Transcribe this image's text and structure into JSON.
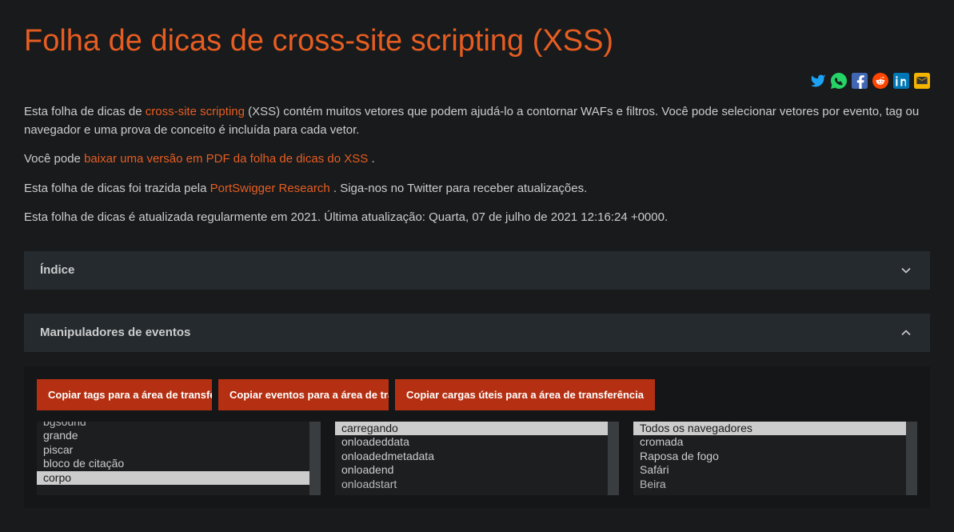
{
  "title": "Folha de dicas de cross-site scripting (XSS)",
  "social": {
    "twitter": "twitter-icon",
    "whatsapp": "whatsapp-icon",
    "facebook": "facebook-icon",
    "reddit": "reddit-icon",
    "linkedin": "linkedin-icon",
    "email": "email-icon"
  },
  "intro": {
    "p1_a": "Esta folha de dicas de ",
    "p1_link": "cross-site scripting",
    "p1_b": " (XSS) contém muitos vetores que podem ajudá-lo a contornar WAFs e filtros. Você pode selecionar vetores por evento, tag ou navegador e uma prova de conceito é incluída para cada vetor.",
    "p2_a": "Você pode ",
    "p2_link": "baixar uma versão em PDF da folha de dicas do XSS ",
    "p2_b": ".",
    "p3_a": "Esta folha de dicas foi trazida pela ",
    "p3_link": "PortSwigger Research ",
    "p3_b": ". Siga-nos no Twitter para receber atualizações.",
    "p4": "Esta folha de dicas é atualizada regularmente em 2021. Última atualização: Quarta, 07 de julho de 2021 12:16:24 +0000."
  },
  "sections": {
    "index": {
      "title": "Índice"
    },
    "handlers": {
      "title": "Manipuladores de eventos",
      "btn_tags": "Copiar tags para a área de transferência",
      "btn_events": "Copiar eventos para a área de transferência",
      "btn_payloads": "Copiar cargas úteis para a área de transferência",
      "tags": {
        "opt_topcut": "bgsound",
        "opt1": "grande",
        "opt2": "piscar",
        "opt3": "bloco de citação",
        "opt_selected": "corpo"
      },
      "events": {
        "opt_selected": "carregando",
        "opt1": "onloadeddata",
        "opt2": "onloadedmetadata",
        "opt3": "onloadend",
        "opt_botcut": "onloadstart"
      },
      "browsers": {
        "opt_selected": "Todos os navegadores",
        "opt1": "cromada",
        "opt2": "Raposa de fogo",
        "opt3": "Safári",
        "opt_botcut": "Beira"
      }
    }
  }
}
